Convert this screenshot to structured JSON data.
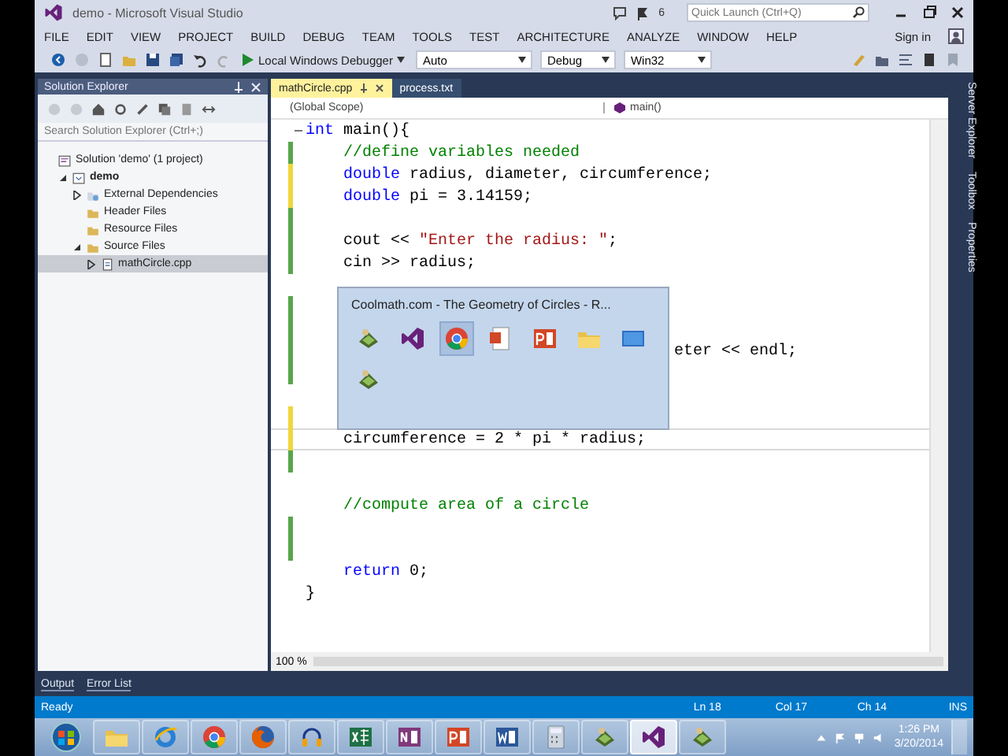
{
  "window": {
    "title": "demo - Microsoft Visual Studio",
    "notifications": "6",
    "quick_launch": {
      "placeholder": "Quick Launch (Ctrl+Q)"
    }
  },
  "menu": [
    "FILE",
    "EDIT",
    "VIEW",
    "PROJECT",
    "BUILD",
    "DEBUG",
    "TEAM",
    "TOOLS",
    "TEST",
    "ARCHITECTURE",
    "ANALYZE",
    "WINDOW",
    "HELP"
  ],
  "sign_in": "Sign in",
  "toolbar": {
    "debugger": "Local Windows Debugger",
    "dropdowns": [
      "Auto",
      "Debug",
      "Win32"
    ]
  },
  "solution_explorer": {
    "title": "Solution Explorer",
    "search": {
      "placeholder": "Search Solution Explorer (Ctrl+;)"
    },
    "tree": [
      {
        "label": "Solution 'demo' (1 project)",
        "kind": "solution",
        "selected": false,
        "children": [
          {
            "label": "demo",
            "kind": "project",
            "expanded": true,
            "selected": false,
            "children": [
              {
                "label": "External Dependencies",
                "kind": "dependencies",
                "expanded": false,
                "selected": false
              },
              {
                "label": "Header Files",
                "kind": "folder",
                "selected": false
              },
              {
                "label": "Resource Files",
                "kind": "folder",
                "selected": false
              },
              {
                "label": "Source Files",
                "kind": "folder",
                "expanded": true,
                "selected": false,
                "children": [
                  {
                    "label": "mathCircle.cpp",
                    "kind": "file",
                    "expanded": false,
                    "selected": true
                  }
                ]
              }
            ]
          }
        ]
      }
    ]
  },
  "editor": {
    "tabs": [
      {
        "label": "mathCircle.cpp",
        "selected": true
      },
      {
        "label": "process.txt",
        "selected": false
      }
    ],
    "scope": "(Global Scope)",
    "member": "main()",
    "zoom": "100 %",
    "lines": [
      {
        "kind": "code",
        "fold": true,
        "tokens": [
          {
            "kind": "keyword",
            "text": "int"
          },
          {
            "kind": "plain",
            "text": " main(){"
          }
        ]
      },
      {
        "kind": "code",
        "color": "#57a64a",
        "tokens": [
          {
            "kind": "comment",
            "text": "    //define variables needed"
          }
        ]
      },
      {
        "kind": "code",
        "color": "#efd73a",
        "tokens": [
          {
            "kind": "keyword",
            "text": "    double"
          },
          {
            "kind": "plain",
            "text": " radius, diameter, circumference;"
          }
        ]
      },
      {
        "kind": "code",
        "color": "#efd73a",
        "tokens": [
          {
            "kind": "keyword",
            "text": "    double"
          },
          {
            "kind": "plain",
            "text": " pi = 3.14159;"
          }
        ]
      },
      {
        "kind": "blank",
        "color": "#57a64a"
      },
      {
        "kind": "code",
        "color": "#57a64a",
        "tokens": [
          {
            "kind": "plain",
            "text": "    cout << "
          },
          {
            "kind": "string",
            "text": "\"Enter the radius: \""
          },
          {
            "kind": "plain",
            "text": ";"
          }
        ]
      },
      {
        "kind": "code",
        "color": "#57a64a",
        "tokens": [
          {
            "kind": "plain",
            "text": "    cin >> radius;"
          }
        ]
      },
      {
        "kind": "blank"
      },
      {
        "kind": "blank",
        "color": "#57a64a"
      },
      {
        "kind": "blank",
        "color": "#57a64a"
      },
      {
        "kind": "code",
        "color": "#57a64a",
        "tokens": [
          {
            "kind": "plain",
            "text": "                                       eter << endl;"
          }
        ]
      },
      {
        "kind": "blank",
        "color": "#57a64a"
      },
      {
        "kind": "blank"
      },
      {
        "kind": "blank",
        "color": "#efd73a"
      },
      {
        "kind": "code",
        "color": "#efd73a",
        "current": true,
        "tokens": [
          {
            "kind": "plain",
            "text": "    circumference = 2 * pi * radius;"
          }
        ]
      },
      {
        "kind": "blank",
        "color": "#57a64a"
      },
      {
        "kind": "blank"
      },
      {
        "kind": "code",
        "tokens": [
          {
            "kind": "comment",
            "text": "    //compute area of a circle"
          }
        ]
      },
      {
        "kind": "blank",
        "color": "#57a64a"
      },
      {
        "kind": "blank",
        "color": "#57a64a"
      },
      {
        "kind": "code",
        "tokens": [
          {
            "kind": "keyword",
            "text": "    return"
          },
          {
            "kind": "plain",
            "text": " 0;"
          }
        ]
      },
      {
        "kind": "code",
        "tokens": [
          {
            "kind": "plain",
            "text": "}"
          }
        ]
      }
    ]
  },
  "popup": {
    "title": "Coolmath.com - The Geometry of Circles - R...",
    "windows": [
      {
        "kind": "board",
        "selected": false
      },
      {
        "kind": "vs",
        "selected": false
      },
      {
        "kind": "chrome",
        "selected": true
      },
      {
        "kind": "pdf",
        "selected": false
      },
      {
        "kind": "slides",
        "selected": false
      },
      {
        "kind": "folder",
        "selected": false
      },
      {
        "kind": "screen",
        "selected": false
      },
      {
        "kind": "board",
        "selected": false
      }
    ]
  },
  "side_tabs": [
    "Server Explorer",
    "Toolbox",
    "Properties"
  ],
  "bottom_tabs": [
    "Output",
    "Error List"
  ],
  "status": {
    "message": "Ready",
    "line": "Ln 18",
    "column": "Col 17",
    "char": "Ch 14",
    "mode": "INS"
  },
  "taskbar": {
    "apps": [
      {
        "kind": "folder",
        "active": false
      },
      {
        "kind": "ie",
        "active": false
      },
      {
        "kind": "chrome",
        "active": false
      },
      {
        "kind": "firefox",
        "active": false
      },
      {
        "kind": "headphones",
        "active": false
      },
      {
        "kind": "sheet",
        "active": false
      },
      {
        "kind": "note",
        "active": false
      },
      {
        "kind": "slides",
        "active": false
      },
      {
        "kind": "doc",
        "active": false
      },
      {
        "kind": "calculator",
        "active": false
      },
      {
        "kind": "board",
        "active": false
      },
      {
        "kind": "vs",
        "active": true
      },
      {
        "kind": "board",
        "active": false
      }
    ],
    "time": "1:26 PM",
    "date": "3/20/2014"
  }
}
